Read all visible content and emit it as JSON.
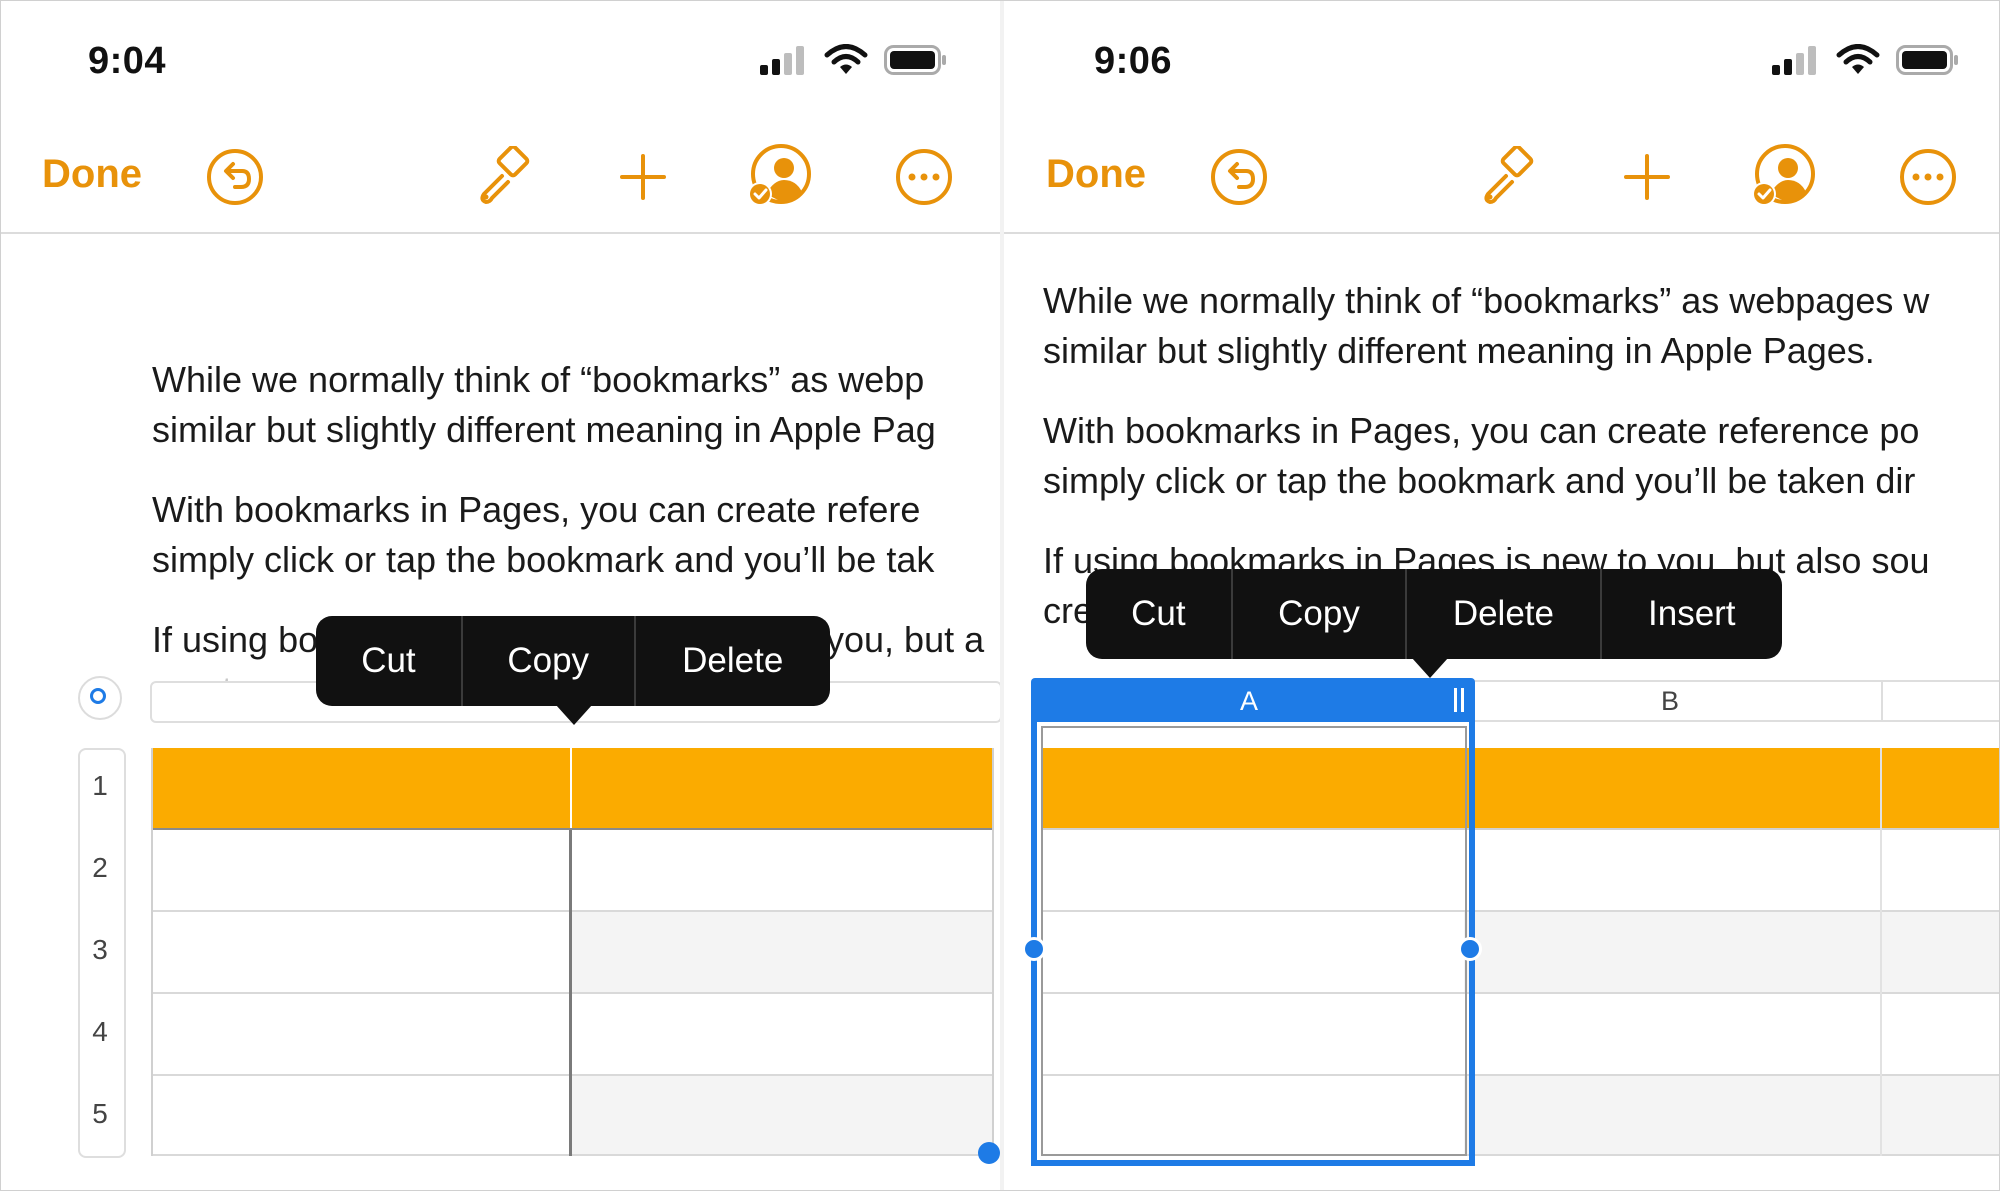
{
  "left_screen": {
    "time": "9:04",
    "toolbar": {
      "done_label": "Done"
    },
    "paragraphs": [
      "While we normally think of “bookmarks” as webp",
      "similar but slightly different meaning in Apple Pag",
      "With bookmarks in Pages, you can create refere",
      "simply click or tap the bookmark and you’ll be tak",
      "If using bo",
      "you, but a",
      "create an"
    ],
    "context_menu": [
      "Cut",
      "Copy",
      "Delete"
    ],
    "row_numbers": [
      "1",
      "2",
      "3",
      "4",
      "5"
    ]
  },
  "right_screen": {
    "time": "9:06",
    "toolbar": {
      "done_label": "Done"
    },
    "paragraphs": [
      "While we normally think of “bookmarks” as webpages w",
      "similar but slightly different meaning in Apple Pages.",
      "With bookmarks in Pages, you can create reference po",
      "simply click or tap the bookmark and you’ll be taken dir",
      "If using bookmarks in Pages is new to you, but also sou",
      "cre"
    ],
    "context_menu": [
      "Cut",
      "Copy",
      "Delete",
      "Insert"
    ],
    "column_letters": [
      "A",
      "B"
    ]
  },
  "colors": {
    "accent": "#E8920A",
    "table_header": "#FBAB00",
    "selection": "#1E7BE6",
    "menu_bg": "#111111"
  },
  "icons": [
    "cellular-signal-icon",
    "wifi-icon",
    "battery-icon",
    "undo-icon",
    "paintbrush-icon",
    "plus-icon",
    "collaborate-icon",
    "more-icon"
  ]
}
